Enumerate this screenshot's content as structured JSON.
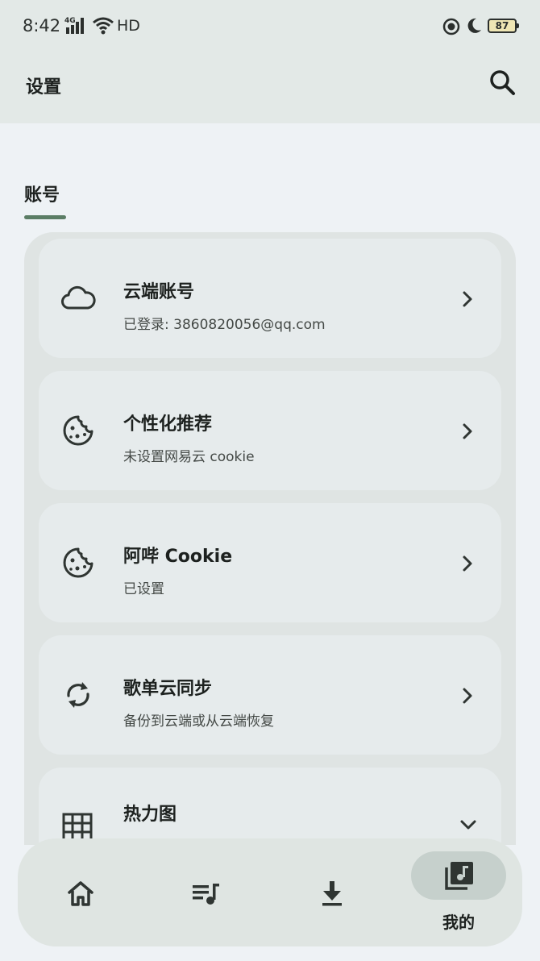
{
  "status_bar": {
    "time": "8:42",
    "network": "4G",
    "hd": "HD",
    "battery": "87"
  },
  "app_bar": {
    "title": "设置",
    "search_icon": "search-icon"
  },
  "section": {
    "tab_label": "账号"
  },
  "settings": {
    "items": [
      {
        "icon": "cloud-icon",
        "title": "云端账号",
        "subtitle": "已登录: 3860820056@qq.com"
      },
      {
        "icon": "cookie-icon",
        "title": "个性化推荐",
        "subtitle": "未设置网易云 cookie"
      },
      {
        "icon": "cookie-icon",
        "title": "阿哔 Cookie",
        "subtitle": "已设置"
      },
      {
        "icon": "sync-icon",
        "title": "歌单云同步",
        "subtitle": "备份到云端或从云端恢复"
      },
      {
        "icon": "grid-icon",
        "title": "热力图",
        "subtitle": ""
      }
    ]
  },
  "bottom_nav": {
    "items": [
      {
        "icon": "home-icon",
        "label": ""
      },
      {
        "icon": "playlist-icon",
        "label": ""
      },
      {
        "icon": "download-icon",
        "label": ""
      },
      {
        "icon": "library-music-icon",
        "label": "我的"
      }
    ],
    "selected": "我的"
  },
  "colors": {
    "accent": "#5b7d65",
    "header_bg": "#e3e9e7",
    "group_bg": "#dfe4e3",
    "item_bg": "#e6ebec",
    "nav_selected": "#c6d0cc"
  }
}
